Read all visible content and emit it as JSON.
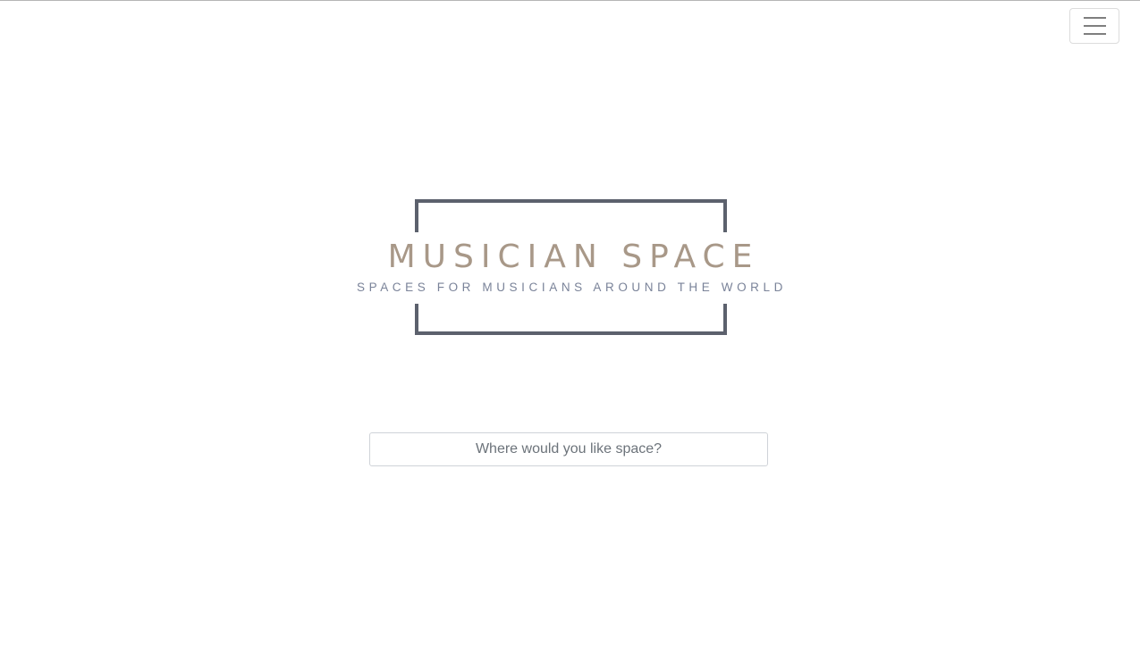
{
  "header": {
    "menu_icon": "hamburger-menu-icon"
  },
  "brand": {
    "title": "MUSICIAN SPACE",
    "subtitle": "SPACES FOR MUSICIANS AROUND THE WORLD",
    "title_color": "#a89888",
    "subtitle_color": "#7a8399",
    "frame_color": "#5c616d"
  },
  "search": {
    "placeholder": "Where would you like space?",
    "value": ""
  }
}
